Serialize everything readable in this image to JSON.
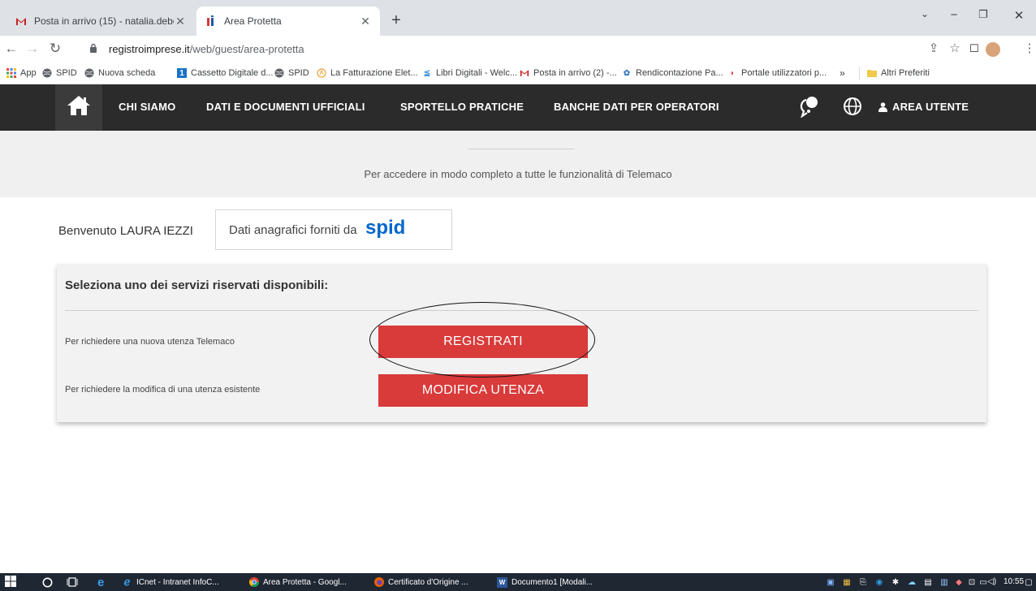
{
  "browser": {
    "tabs": [
      {
        "title": "Posta in arrivo (15) - natalia.debe",
        "icon": "gmail-icon",
        "active": false
      },
      {
        "title": "Area Protetta",
        "icon": "registro-imprese-icon",
        "active": true
      }
    ],
    "new_tab": "+",
    "url_host": "registroimprese.it",
    "url_path": "/web/guest/area-protetta",
    "bookmarks": [
      {
        "label": "App",
        "icon": "apps-grid-icon"
      },
      {
        "label": "SPID",
        "icon": "globe-icon"
      },
      {
        "label": "Nuova scheda",
        "icon": "globe-icon"
      },
      {
        "label": "Cassetto Digitale d...",
        "icon": "cassetto-icon"
      },
      {
        "label": "SPID",
        "icon": "globe-icon"
      },
      {
        "label": "La Fatturazione Elet...",
        "icon": "fattura-icon"
      },
      {
        "label": "Libri Digitali - Welc...",
        "icon": "libri-icon"
      },
      {
        "label": "Posta in arrivo (2) -...",
        "icon": "gmail-icon"
      },
      {
        "label": "Rendicontazione Pa...",
        "icon": "rendicontazione-icon"
      },
      {
        "label": "Portale utilizzatori p...",
        "icon": "portale-icon"
      }
    ],
    "bookmarks_overflow": "»",
    "other_bookmarks": "Altri Preferiti"
  },
  "site": {
    "nav": [
      "CHI SIAMO",
      "DATI E DOCUMENTI UFFICIALI",
      "SPORTELLO PRATICHE",
      "BANCHE DATI PER OPERATORI"
    ],
    "user_area": "AREA UTENTE",
    "banner_text": "Per accedere in modo completo a tutte le funzionalità di Telemaco",
    "welcome": "Benvenuto LAURA IEZZI",
    "spid_label": "Dati anagrafici forniti da",
    "spid_logo": "spid",
    "panel_title": "Seleziona uno dei servizi riservati disponibili:",
    "services": [
      {
        "label": "Per richiedere una nuova utenza Telemaco",
        "button": "REGISTRATI"
      },
      {
        "label": "Per richiedere la modifica di una utenza esistente",
        "button": "MODIFICA UTENZA"
      }
    ],
    "accent": "#d93a3a",
    "nav_bg": "#2b2b2b"
  },
  "taskbar": {
    "items": [
      {
        "label": "ICnet - Intranet InfoC...",
        "icon": "ie-icon"
      },
      {
        "label": "Area Protetta - Googl...",
        "icon": "chrome-icon"
      },
      {
        "label": "Certificato d'Origine ...",
        "icon": "firefox-icon"
      },
      {
        "label": "Documento1 [Modali...",
        "icon": "word-icon"
      }
    ],
    "clock": "10:55"
  }
}
